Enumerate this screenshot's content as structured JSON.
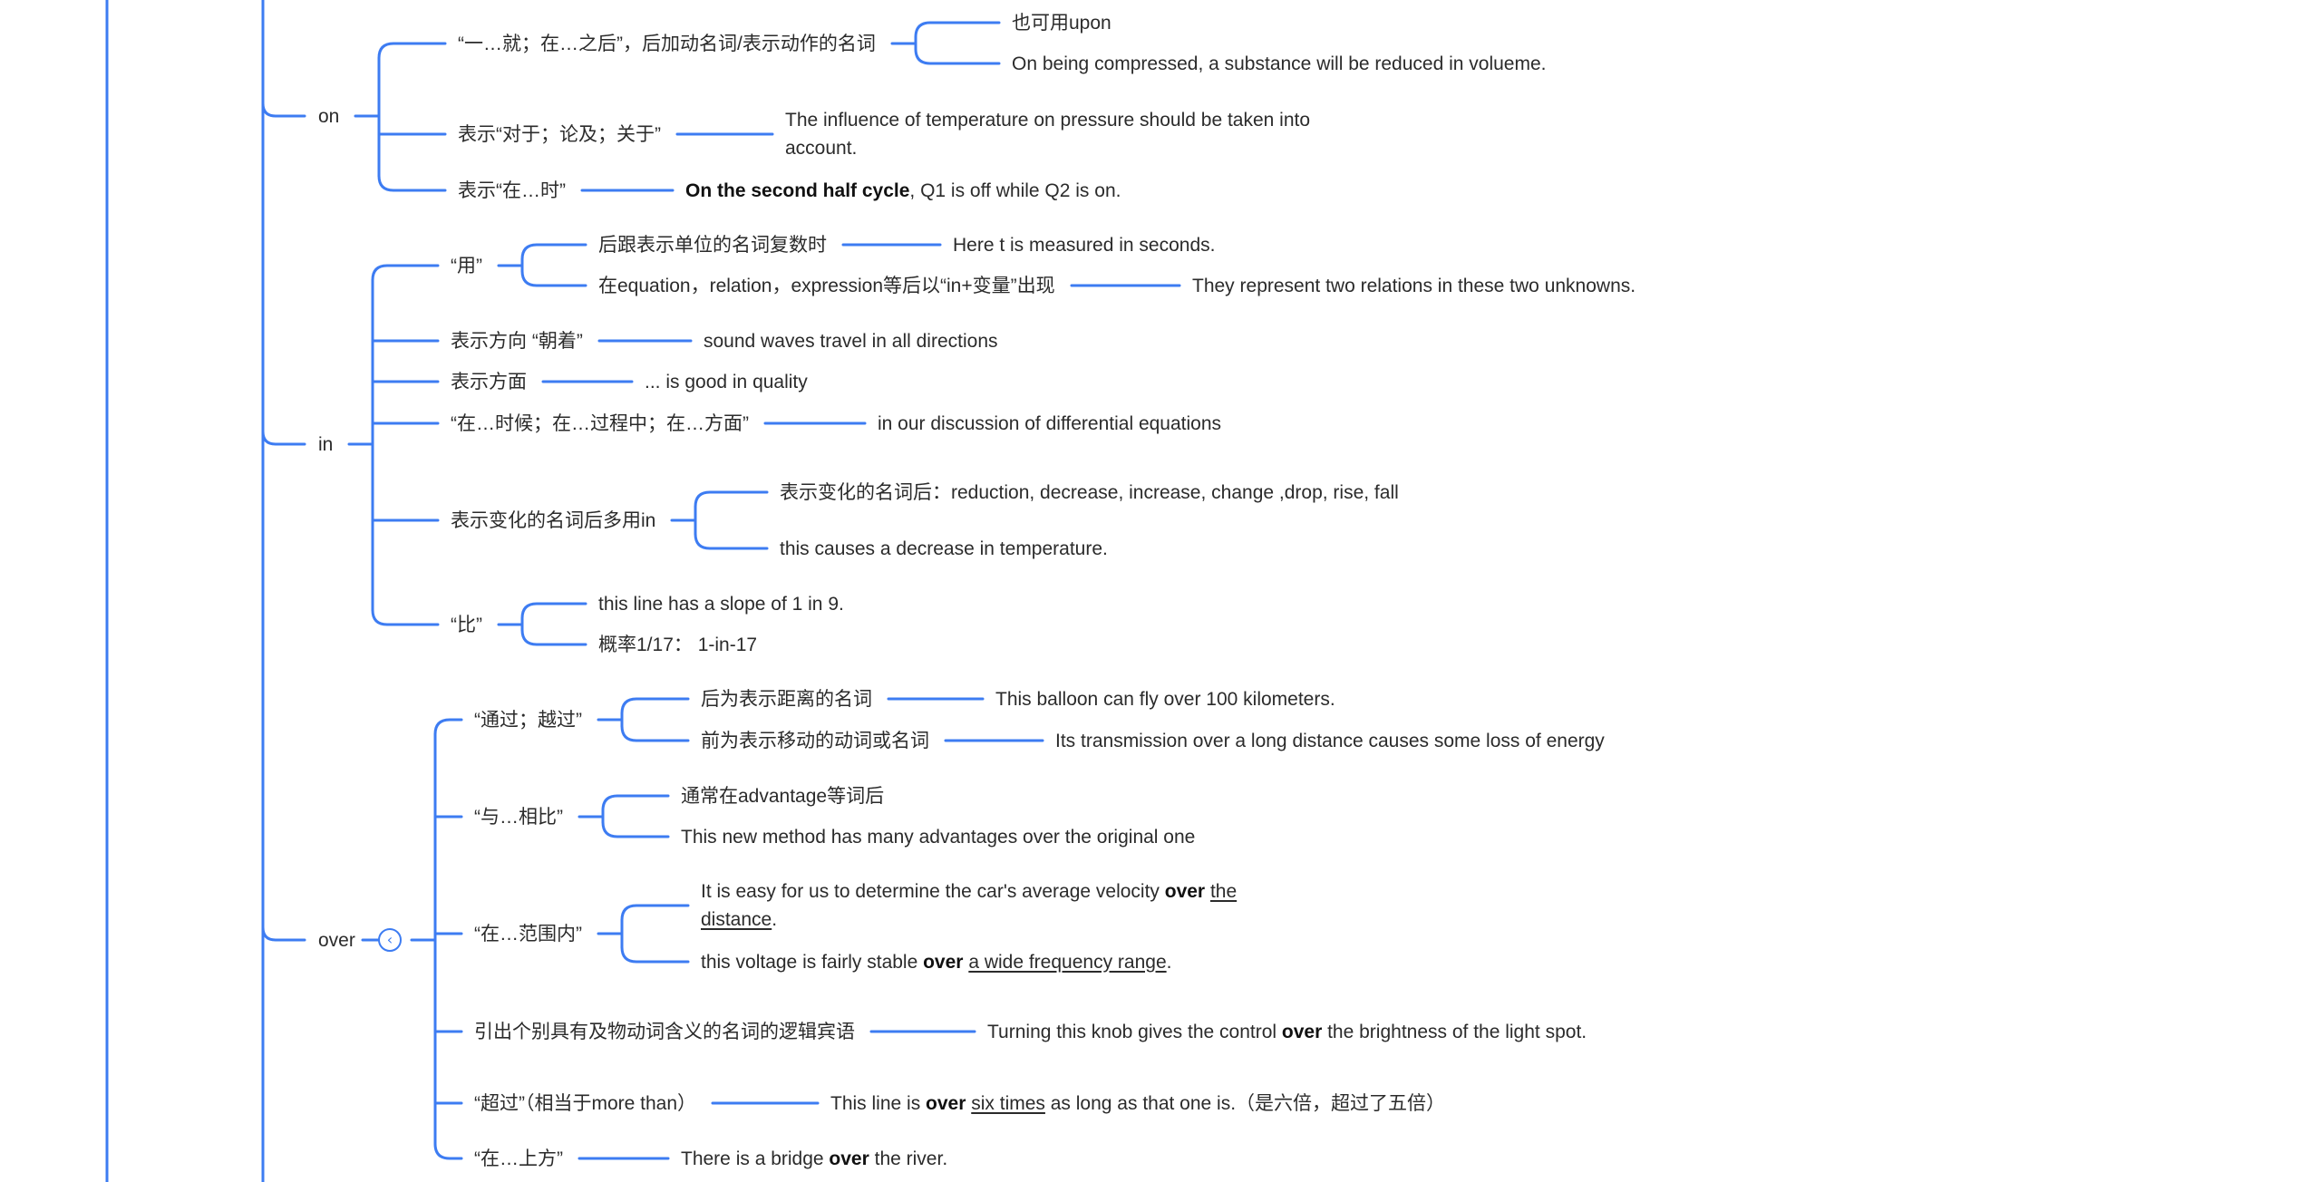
{
  "colors": {
    "line": "#3d7cf2",
    "text": "#2b2b2b",
    "background": "#ffffff"
  },
  "icons": {
    "collapse": "chevron-left-icon"
  },
  "collapse_glyph": "‹",
  "nodes": [
    {
      "id": "on",
      "text": "on"
    },
    {
      "id": "on_a",
      "text": "“一…就；在…之后”，后加动名词/表示动作的名词"
    },
    {
      "id": "on_a1",
      "text": "也可用upon"
    },
    {
      "id": "on_a2",
      "text": "On being compressed, a substance will be reduced in volueme."
    },
    {
      "id": "on_b",
      "text": "表示“对于；论及；关于”"
    },
    {
      "id": "on_b1",
      "text": "The influence of temperature on pressure should be taken into account."
    },
    {
      "id": "on_c",
      "text": "表示“在…时”"
    },
    {
      "id": "on_c1",
      "segments": [
        {
          "t": "On the second half cycle",
          "b": true
        },
        {
          "t": ", Q1 is off while Q2 is on."
        }
      ]
    },
    {
      "id": "in",
      "text": "in"
    },
    {
      "id": "in_a",
      "text": "“用”"
    },
    {
      "id": "in_a1",
      "text": "后跟表示单位的名词复数时"
    },
    {
      "id": "in_a1x",
      "text": "Here t is measured in seconds."
    },
    {
      "id": "in_a2",
      "text": "在equation，relation，expression等后以“in+变量”出现"
    },
    {
      "id": "in_a2x",
      "text": "They represent two relations in these two unknowns."
    },
    {
      "id": "in_b",
      "text": "表示方向 “朝着”"
    },
    {
      "id": "in_b1",
      "text": "sound waves travel in all directions"
    },
    {
      "id": "in_c",
      "text": "表示方面"
    },
    {
      "id": "in_c1",
      "text": "... is good in quality"
    },
    {
      "id": "in_d",
      "text": "“在…时候；在…过程中；在…方面”"
    },
    {
      "id": "in_d1",
      "text": "in our discussion of differential equations"
    },
    {
      "id": "in_e",
      "text": "表示变化的名词后多用in"
    },
    {
      "id": "in_e1",
      "text": "表示变化的名词后：reduction, decrease, increase, change ,drop, rise, fall"
    },
    {
      "id": "in_e2",
      "text": "this causes a decrease in temperature."
    },
    {
      "id": "in_f",
      "text": "“比”"
    },
    {
      "id": "in_f1",
      "text": "this line has a slope of 1 in 9."
    },
    {
      "id": "in_f2",
      "text": "概率1/17：  1-in-17"
    },
    {
      "id": "over",
      "text": "over"
    },
    {
      "id": "ov_a",
      "text": "“通过；越过”"
    },
    {
      "id": "ov_a1",
      "text": "后为表示距离的名词"
    },
    {
      "id": "ov_a1x",
      "text": "This balloon can fly over 100 kilometers."
    },
    {
      "id": "ov_a2",
      "text": "前为表示移动的动词或名词"
    },
    {
      "id": "ov_a2x",
      "text": "Its transmission over a long distance causes some loss of energy"
    },
    {
      "id": "ov_b",
      "text": "“与…相比”"
    },
    {
      "id": "ov_b1",
      "text": "通常在advantage等词后"
    },
    {
      "id": "ov_b2",
      "text": "This new method has many advantages over the original one"
    },
    {
      "id": "ov_c",
      "text": "“在…范围内”"
    },
    {
      "id": "ov_c1",
      "segments": [
        {
          "t": "It is easy for us to determine the car's average velocity "
        },
        {
          "t": "over",
          "b": true
        },
        {
          "t": " "
        },
        {
          "t": "the distance",
          "u": true
        },
        {
          "t": "."
        }
      ]
    },
    {
      "id": "ov_c2",
      "segments": [
        {
          "t": "this voltage is fairly stable "
        },
        {
          "t": "over",
          "b": true
        },
        {
          "t": " "
        },
        {
          "t": "a wide frequency range",
          "u": true
        },
        {
          "t": "."
        }
      ]
    },
    {
      "id": "ov_d",
      "text": "引出个别具有及物动词含义的名词的逻辑宾语"
    },
    {
      "id": "ov_d1",
      "segments": [
        {
          "t": "Turning this knob gives the control "
        },
        {
          "t": "over",
          "b": true
        },
        {
          "t": " the brightness of the light spot."
        }
      ]
    },
    {
      "id": "ov_e",
      "text": "“超过”（相当于more than）"
    },
    {
      "id": "ov_e1",
      "segments": [
        {
          "t": "This line is "
        },
        {
          "t": "over",
          "b": true
        },
        {
          "t": " "
        },
        {
          "t": "six times",
          "u": true
        },
        {
          "t": " as long as that one is.（是六倍，超过了五倍）"
        }
      ]
    },
    {
      "id": "ov_f",
      "text": "“在…上方”"
    },
    {
      "id": "ov_f1",
      "segments": [
        {
          "t": "There is a bridge "
        },
        {
          "t": "over",
          "b": true
        },
        {
          "t": " the river."
        }
      ]
    }
  ]
}
